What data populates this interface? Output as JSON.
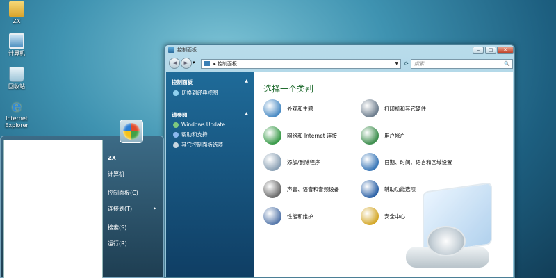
{
  "desktop": {
    "icons": [
      {
        "label": "ZX",
        "icon": "folder-icon"
      },
      {
        "label": "计算机",
        "icon": "computer-icon"
      },
      {
        "label": "回收站",
        "icon": "recycle-bin-icon"
      },
      {
        "label": "Internet Explorer",
        "icon": "internet-explorer-icon"
      }
    ]
  },
  "window": {
    "title": "控制面板",
    "controls": {
      "minimize": "‒",
      "maximize": "□",
      "close": "✕"
    },
    "nav": {
      "back": "◄",
      "forward": "►",
      "history": "▾"
    },
    "address": {
      "value": "控制面板",
      "prefix": "▸"
    },
    "refresh": "⟳",
    "search": {
      "placeholder": "搜索",
      "icon": "🔍"
    },
    "left_pane": {
      "section1_title": "控制面板",
      "section1_links": [
        "切换到经典视图"
      ],
      "section2_title": "请参阅",
      "section2_links": [
        "Windows Update",
        "帮助和支持",
        "其它控制面板选项"
      ]
    },
    "main": {
      "heading": "选择一个类别",
      "categories_left": [
        {
          "label": "外观和主题",
          "color": "#4a8bc4"
        },
        {
          "label": "网络和 Internet 连接",
          "color": "#3a9b4a"
        },
        {
          "label": "添加/删除程序",
          "color": "#8aa0b4"
        },
        {
          "label": "声音、语音和音频设备",
          "color": "#6b6b6b"
        },
        {
          "label": "性能和维护",
          "color": "#5577aa"
        }
      ],
      "categories_right": [
        {
          "label": "打印机和其它硬件",
          "color": "#6f7f8f"
        },
        {
          "label": "用户帐户",
          "color": "#3f8f4f"
        },
        {
          "label": "日期、时间、语言和区域设置",
          "color": "#3b78b8"
        },
        {
          "label": "辅助功能选项",
          "color": "#2f64a8"
        },
        {
          "label": "安全中心",
          "color": "#d4a82a"
        }
      ]
    }
  },
  "start_menu": {
    "right_items": [
      "ZX",
      "计算机",
      "控制面板(C)",
      "连接到(T)",
      "搜索(S)",
      "运行(R)..."
    ],
    "submenu_arrow": "▸"
  }
}
